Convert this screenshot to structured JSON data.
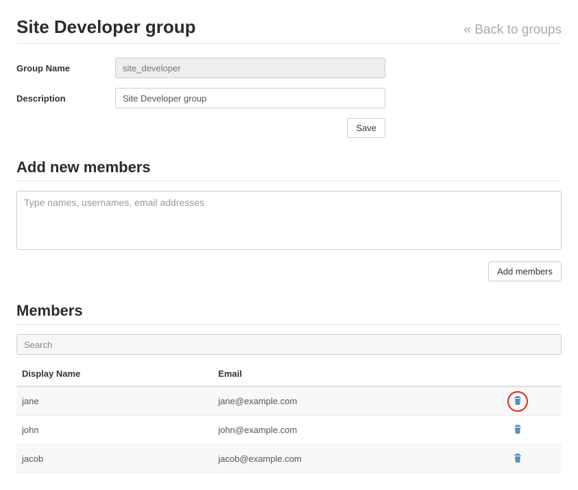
{
  "header": {
    "title": "Site Developer group",
    "back_label": "« Back to groups"
  },
  "form": {
    "group_name_label": "Group Name",
    "group_name_value": "site_developer",
    "description_label": "Description",
    "description_value": "Site Developer group",
    "save_label": "Save"
  },
  "add_members": {
    "section_title": "Add new members",
    "placeholder": "Type names, usernames, email addresses",
    "button_label": "Add members"
  },
  "members": {
    "section_title": "Members",
    "search_placeholder": "Search",
    "columns": {
      "display_name": "Display Name",
      "email": "Email"
    },
    "rows": [
      {
        "display_name": "jane",
        "email": "jane@example.com",
        "highlighted": true
      },
      {
        "display_name": "john",
        "email": "john@example.com",
        "highlighted": false
      },
      {
        "display_name": "jacob",
        "email": "jacob@example.com",
        "highlighted": false
      }
    ]
  }
}
